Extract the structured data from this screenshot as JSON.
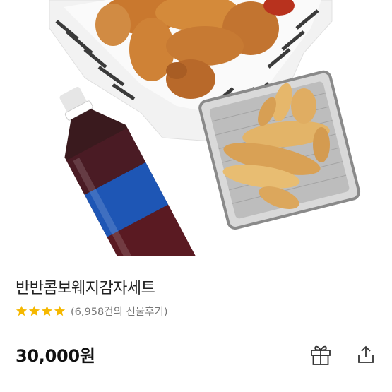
{
  "product": {
    "name": "반반콤보웨지감자세트",
    "price": "30,000원",
    "rating": {
      "stars": 4,
      "reviews_text": "(6,958건의 선물후기)"
    }
  },
  "actions": {
    "gift_icon": "gift-icon",
    "share_icon": "share-icon"
  },
  "colors": {
    "star": "#F5B800",
    "text": "#222222",
    "muted": "#777777"
  }
}
